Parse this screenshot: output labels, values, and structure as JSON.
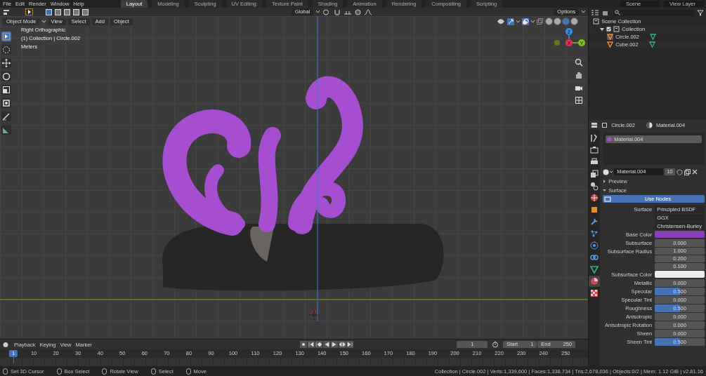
{
  "menu": [
    "File",
    "Edit",
    "Render",
    "Window",
    "Help"
  ],
  "workspaces": [
    {
      "label": "Layout",
      "selected": true
    },
    {
      "label": "Modeling",
      "selected": false
    },
    {
      "label": "Sculpting",
      "selected": false
    },
    {
      "label": "UV Editing",
      "selected": false
    },
    {
      "label": "Texture Paint",
      "selected": false
    },
    {
      "label": "Shading",
      "selected": false
    },
    {
      "label": "Animation",
      "selected": false
    },
    {
      "label": "Rendering",
      "selected": false
    },
    {
      "label": "Compositing",
      "selected": false
    },
    {
      "label": "Scripting",
      "selected": false
    }
  ],
  "scene": "Scene",
  "view_layer": "View Layer",
  "tool_header": {
    "orientation": "Global",
    "options": "Options"
  },
  "viewport": {
    "mode": "Object Mode",
    "menus": [
      "View",
      "Select",
      "Add",
      "Object"
    ],
    "overlay_text": [
      "Right Orthographic",
      "(1) Collection | Circle.002",
      "Meters"
    ],
    "gizmo": {
      "z": "Z",
      "x": "X",
      "y": "Y"
    },
    "shading": [
      {
        "selected": false
      },
      {
        "selected": false
      },
      {
        "selected": true
      },
      {
        "selected": false
      }
    ]
  },
  "outliner": {
    "items": [
      {
        "label": "Scene Collection",
        "children": [
          {
            "label": "Collection",
            "expanded": true,
            "checked": true,
            "children": [
              {
                "label": "Circle.002",
                "selected": true
              },
              {
                "label": "Cube.002",
                "selected": false
              }
            ]
          }
        ]
      }
    ]
  },
  "properties": {
    "object": "Circle.002",
    "material": "Material.004",
    "tabs": [
      {
        "kind": "tool",
        "selected": false
      },
      {
        "kind": "render",
        "selected": false
      },
      {
        "kind": "output",
        "selected": false
      },
      {
        "kind": "view_layer",
        "selected": false
      },
      {
        "kind": "scene",
        "selected": false
      },
      {
        "kind": "world",
        "selected": false
      },
      {
        "kind": "object",
        "selected": false
      },
      {
        "kind": "modifiers",
        "selected": false
      },
      {
        "kind": "particles",
        "selected": false
      },
      {
        "kind": "physics",
        "selected": false
      },
      {
        "kind": "constraints",
        "selected": false
      },
      {
        "kind": "data",
        "selected": false
      },
      {
        "kind": "material",
        "selected": true
      },
      {
        "kind": "texture",
        "selected": false
      }
    ],
    "slots": [
      {
        "label": "Material.004",
        "selected": true
      }
    ],
    "material_field": {
      "value": "Material.004",
      "users": "10"
    },
    "panels": [
      {
        "label": "Preview",
        "expanded": false
      },
      {
        "label": "Surface",
        "expanded": true
      }
    ],
    "use_nodes": "Use Nodes",
    "rows": [
      {
        "label": "Surface",
        "kind": "dropdown",
        "value": "Principled BSDF"
      },
      {
        "kind": "dropdown",
        "value": "GGX"
      },
      {
        "kind": "dropdown",
        "value": "Christensen-Burley"
      },
      {
        "label": "Base Color",
        "kind": "color",
        "color": "#8b3fb5"
      },
      {
        "label": "Subsurface",
        "kind": "slider",
        "value": "0.000"
      },
      {
        "label": "Subsurface Radius",
        "kind": "vector",
        "values": [
          "1.000",
          "0.200",
          "0.100"
        ]
      },
      {
        "label": "Subsurface Color",
        "kind": "color",
        "color": "#ececec"
      },
      {
        "label": "Metallic",
        "kind": "slider",
        "value": "0.000"
      },
      {
        "label": "Specular",
        "kind": "slider",
        "value": "0.500",
        "level": 0.5
      },
      {
        "label": "Specular Tint",
        "kind": "slider",
        "value": "0.000"
      },
      {
        "label": "Roughness",
        "kind": "slider",
        "value": "0.500",
        "level": 0.5
      },
      {
        "label": "Anisotropic",
        "kind": "slider",
        "value": "0.000"
      },
      {
        "label": "Anisotropic Rotation",
        "kind": "slider",
        "value": "0.000"
      },
      {
        "label": "Sheen",
        "kind": "slider",
        "value": "0.000"
      },
      {
        "label": "Sheen Tint",
        "kind": "slider",
        "value": "0.500",
        "level": 0.5
      }
    ]
  },
  "timeline": {
    "menus": [
      "Playback",
      "Keying",
      "View",
      "Marker"
    ],
    "current_frame": "1",
    "start_label": "Start",
    "start": "1",
    "end_label": "End",
    "end": "250",
    "ruler": [
      {
        "label": "1",
        "selected": true
      },
      {
        "label": "10",
        "selected": false
      },
      {
        "label": "20",
        "selected": false
      },
      {
        "label": "30",
        "selected": false
      },
      {
        "label": "40",
        "selected": false
      },
      {
        "label": "50",
        "selected": false
      },
      {
        "label": "60",
        "selected": false
      },
      {
        "label": "70",
        "selected": false
      },
      {
        "label": "80",
        "selected": false
      },
      {
        "label": "90",
        "selected": false
      },
      {
        "label": "100",
        "selected": false
      },
      {
        "label": "110",
        "selected": false
      },
      {
        "label": "120",
        "selected": false
      },
      {
        "label": "130",
        "selected": false
      },
      {
        "label": "140",
        "selected": false
      },
      {
        "label": "150",
        "selected": false
      },
      {
        "label": "160",
        "selected": false
      },
      {
        "label": "170",
        "selected": false
      },
      {
        "label": "180",
        "selected": false
      },
      {
        "label": "190",
        "selected": false
      },
      {
        "label": "200",
        "selected": false
      },
      {
        "label": "210",
        "selected": false
      },
      {
        "label": "220",
        "selected": false
      },
      {
        "label": "230",
        "selected": false
      },
      {
        "label": "240",
        "selected": false
      },
      {
        "label": "250",
        "selected": false
      }
    ]
  },
  "status": {
    "hints": [
      "Set 3D Cursor",
      "Box Select",
      "Rotate View",
      "Select",
      "Move"
    ],
    "info": "Collection | Circle.002 | Verts:1,339,600 | Faces:1,338,734 | Tris:2,678,036 | Objects:0/2 | Mem: 1.12 GiB | v2.81.16"
  }
}
